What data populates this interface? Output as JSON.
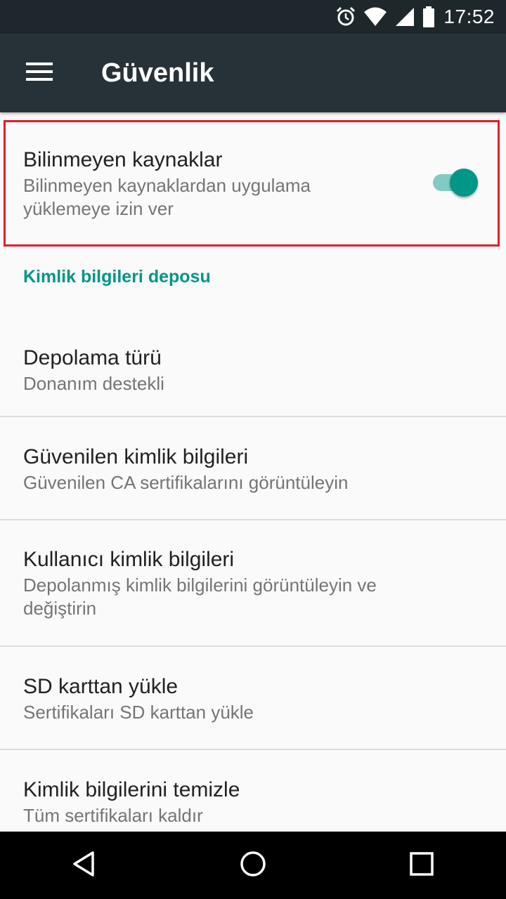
{
  "status_bar": {
    "time": "17:52",
    "icons": [
      "alarm-icon",
      "wifi-icon",
      "signal-icon",
      "battery-icon"
    ]
  },
  "app_bar": {
    "title": "Güvenlik",
    "menu_icon": "hamburger-menu-icon"
  },
  "unknown_sources": {
    "title": "Bilinmeyen kaynaklar",
    "summary_line1": "Bilinmeyen kaynaklardan uygulama",
    "summary_line2": "yüklemeye izin ver",
    "enabled": true
  },
  "credential_storage": {
    "header": "Kimlik bilgileri deposu",
    "items": [
      {
        "title": "Depolama türü",
        "summary": [
          "Donanım destekli"
        ]
      },
      {
        "title": "Güvenilen kimlik bilgileri",
        "summary": [
          "Güvenilen CA sertifikalarını görüntüleyin"
        ]
      },
      {
        "title": "Kullanıcı kimlik bilgileri",
        "summary": [
          "Depolanmış kimlik bilgilerini görüntüleyin ve",
          "değiştirin"
        ]
      },
      {
        "title": "SD karttan yükle",
        "summary": [
          "Sertifikaları SD karttan yükle"
        ]
      },
      {
        "title": "Kimlik bilgilerini temizle",
        "summary": [
          "Tüm sertifikaları kaldır"
        ]
      }
    ]
  },
  "colors": {
    "accent": "#009688",
    "app_bar": "#263238",
    "status_bar": "#1e272c",
    "highlight": "#e01e2a"
  },
  "nav_bar": {
    "icons": [
      "back-icon",
      "home-icon",
      "recents-icon"
    ]
  }
}
